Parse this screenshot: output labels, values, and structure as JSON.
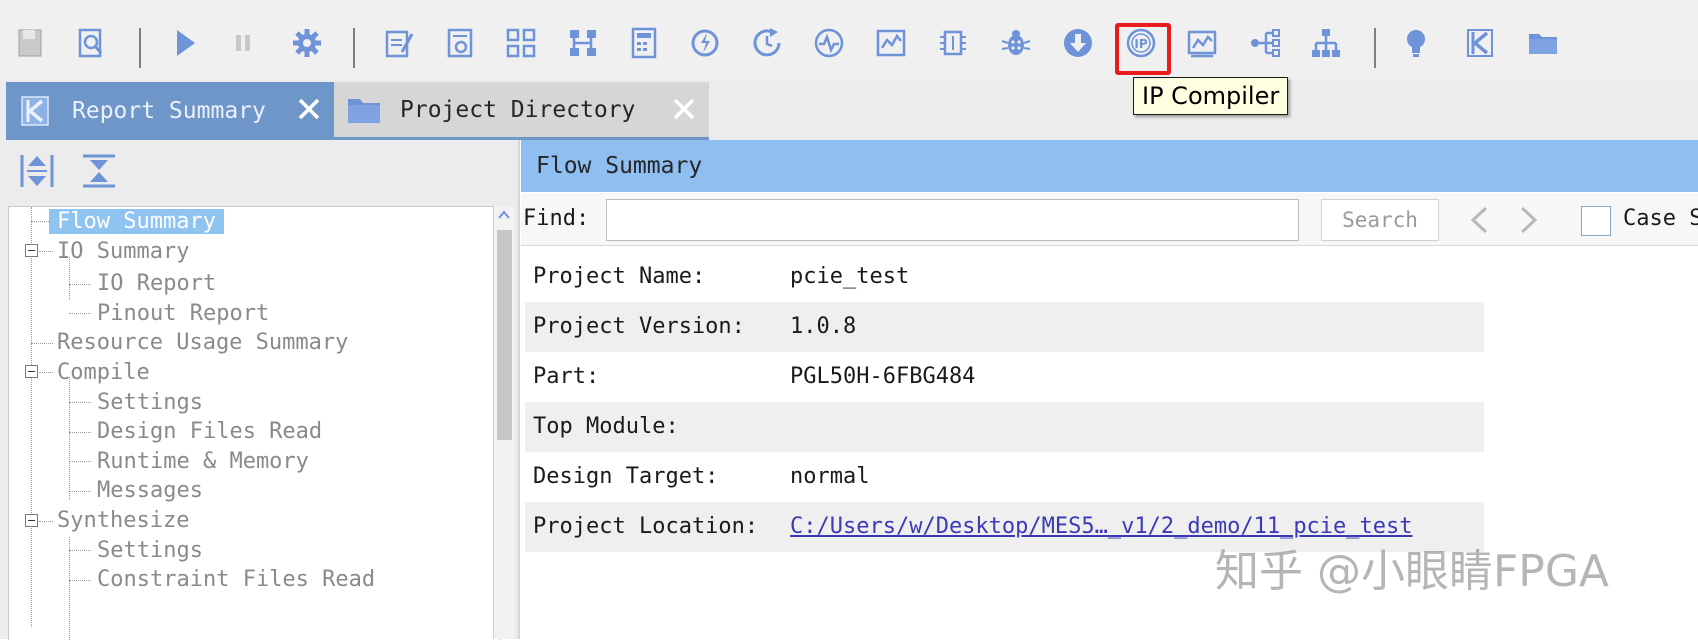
{
  "toolbar": {
    "icons": [
      "save-icon",
      "search-file-icon",
      "run-icon",
      "pause-icon",
      "settings-icon",
      "edit-doc-icon",
      "report-settings-icon",
      "grid-icon",
      "hierarchy-icon",
      "calculator-icon",
      "refresh-icon",
      "clock-refresh-icon",
      "waveform-icon",
      "chart-icon",
      "chip-icon",
      "debug-bug-icon",
      "download-icon",
      "ip-compiler-icon",
      "monitor-chart-icon",
      "network-icon",
      "tree-icon",
      "bulb-icon",
      "k-logo-icon",
      "folder-icon"
    ],
    "tooltip": "IP Compiler"
  },
  "tabs": [
    {
      "label": "Report Summary",
      "icon": "k-logo-icon"
    },
    {
      "label": "Project Directory",
      "icon": "folder-icon"
    }
  ],
  "left_toolbar": {
    "icons": [
      "expand-all-icon",
      "collapse-all-icon"
    ]
  },
  "tree": [
    {
      "label": "Flow Summary",
      "level": 0,
      "selected": true
    },
    {
      "label": "IO Summary",
      "level": 0,
      "expandable": true
    },
    {
      "label": "IO Report",
      "level": 1
    },
    {
      "label": "Pinout Report",
      "level": 1
    },
    {
      "label": "Resource Usage Summary",
      "level": 0
    },
    {
      "label": "Compile",
      "level": 0,
      "expandable": true
    },
    {
      "label": "Settings",
      "level": 1
    },
    {
      "label": "Design Files Read",
      "level": 1
    },
    {
      "label": "Runtime & Memory",
      "level": 1
    },
    {
      "label": "Messages",
      "level": 1
    },
    {
      "label": "Synthesize",
      "level": 0,
      "expandable": true
    },
    {
      "label": "Settings",
      "level": 1
    },
    {
      "label": "Constraint Files Read",
      "level": 1
    }
  ],
  "panel": {
    "title": "Flow Summary",
    "find_label": "Find:",
    "find_value": "",
    "search_button": "Search",
    "case_label": "Case S"
  },
  "summary": [
    {
      "key": "Project Name:",
      "value": "pcie_test"
    },
    {
      "key": "Project Version:",
      "value": "1.0.8"
    },
    {
      "key": "Part:",
      "value": "PGL50H-6FBG484"
    },
    {
      "key": "Top Module:",
      "value": ""
    },
    {
      "key": "Design Target:",
      "value": "normal"
    },
    {
      "key": "Project Location:",
      "value": "C:/Users/w/Desktop/MES5…_v1/2_demo/11_pcie_test",
      "is_link": true
    }
  ],
  "watermark": "知乎 @小眼睛FPGA",
  "colors": {
    "accent": "#6e96c9",
    "header_blue": "#8fbef0",
    "selection": "#8fc3f0",
    "icon_blue": "#6f93d8",
    "highlight_red": "#e81c1c",
    "tooltip_bg": "#ffffe1",
    "link": "#3a3ab8"
  }
}
